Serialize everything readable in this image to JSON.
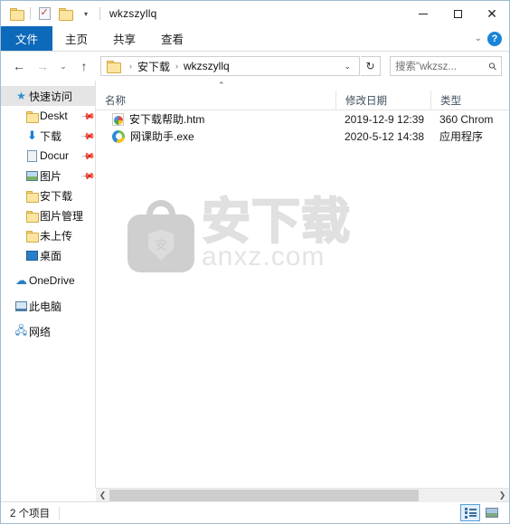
{
  "window": {
    "title": "wkzszyllq",
    "quick_access_toolbar": [
      {
        "name": "folder-icon",
        "label": ""
      },
      {
        "name": "properties-icon",
        "label": ""
      },
      {
        "name": "new-folder-icon",
        "label": ""
      },
      {
        "name": "customize-dropdown-icon",
        "label": "▾"
      }
    ],
    "controls": {
      "minimize": "–",
      "maximize": "□",
      "close": "✕"
    }
  },
  "ribbon": {
    "tabs": [
      {
        "label": "文件",
        "active": true
      },
      {
        "label": "主页",
        "active": false
      },
      {
        "label": "共享",
        "active": false
      },
      {
        "label": "查看",
        "active": false
      }
    ],
    "collapse_chevron": "⌄",
    "help_label": "?"
  },
  "addressbar": {
    "back": "←",
    "forward": "→",
    "recent": "⌄",
    "up": "↑",
    "breadcrumbs": [
      "安下载",
      "wkzszyllq"
    ],
    "breadcrumb_separator": "›",
    "dropdown": "⌄",
    "refresh": "↻",
    "search_placeholder": "搜索\"wkzsz...",
    "search_value": ""
  },
  "sidebar": {
    "items": [
      {
        "label": "快速访问",
        "icon": "star-icon",
        "level": 0,
        "selected": true,
        "pinned": false
      },
      {
        "label": "Deskt",
        "icon": "folder-icon",
        "level": 1,
        "selected": false,
        "pinned": true
      },
      {
        "label": "下载",
        "icon": "download-arrow-icon",
        "level": 1,
        "selected": false,
        "pinned": true
      },
      {
        "label": "Docur",
        "icon": "document-icon",
        "level": 1,
        "selected": false,
        "pinned": true
      },
      {
        "label": "图片",
        "icon": "picture-icon",
        "level": 1,
        "selected": false,
        "pinned": true
      },
      {
        "label": "安下载",
        "icon": "folder-icon",
        "level": 1,
        "selected": false,
        "pinned": false
      },
      {
        "label": "图片管理",
        "icon": "folder-icon",
        "level": 1,
        "selected": false,
        "pinned": false
      },
      {
        "label": "未上传",
        "icon": "folder-icon",
        "level": 1,
        "selected": false,
        "pinned": false
      },
      {
        "label": "桌面",
        "icon": "desktop-icon",
        "level": 1,
        "selected": false,
        "pinned": false
      },
      {
        "label": "OneDrive",
        "icon": "cloud-icon",
        "level": 0,
        "selected": false,
        "pinned": false
      },
      {
        "label": "此电脑",
        "icon": "this-pc-icon",
        "level": 0,
        "selected": false,
        "pinned": false
      },
      {
        "label": "网络",
        "icon": "network-icon",
        "level": 0,
        "selected": false,
        "pinned": false
      }
    ],
    "pin_glyph": "📌"
  },
  "filelist": {
    "sort_indicator": "⌃",
    "columns": [
      {
        "label": "名称"
      },
      {
        "label": "修改日期"
      },
      {
        "label": "类型"
      }
    ],
    "rows": [
      {
        "name": "安下载帮助.htm",
        "date": "2019-12-9 12:39",
        "type": "360 Chrom",
        "icon": "html-file-icon"
      },
      {
        "name": "网课助手.exe",
        "date": "2020-5-12 14:38",
        "type": "应用程序",
        "icon": "application-icon"
      }
    ]
  },
  "watermark": {
    "shield_char": "安",
    "text_cn": "安下载",
    "text_en": "anxz.com"
  },
  "scrollbar": {
    "left_arrow": "❮",
    "right_arrow": "❯"
  },
  "statusbar": {
    "item_count": "2 个项目",
    "view_buttons": [
      {
        "name": "details-view-button",
        "active": true
      },
      {
        "name": "large-icons-view-button",
        "active": false
      }
    ]
  },
  "colors": {
    "accent": "#0d69ba",
    "folder": "#fce5a0",
    "selection": "#e5e5e5"
  }
}
